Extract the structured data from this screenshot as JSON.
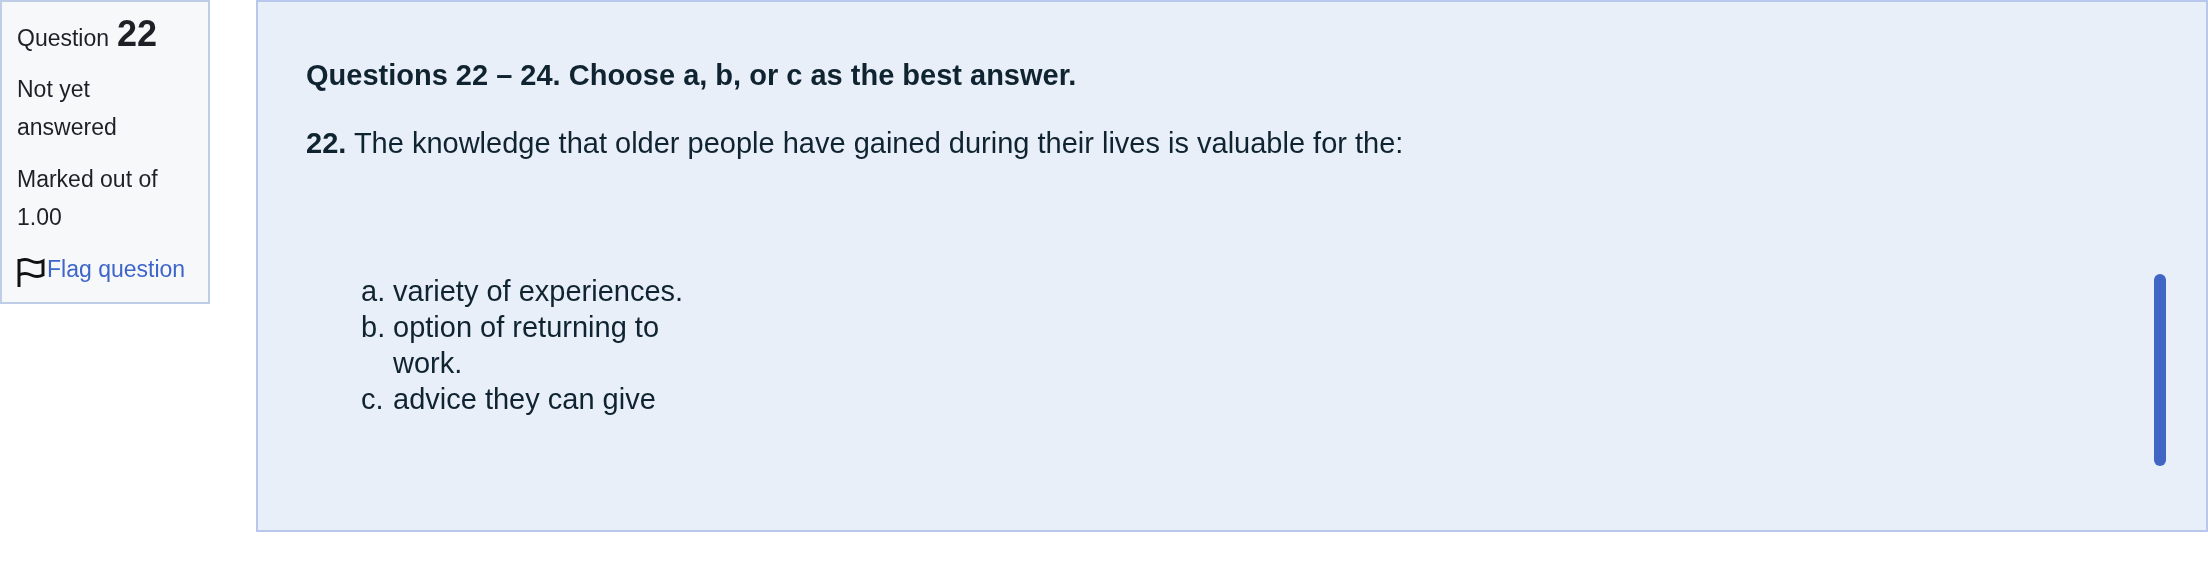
{
  "info": {
    "question_label": "Question",
    "question_number": "22",
    "state": "Not yet answered",
    "marks": "Marked out of 1.00",
    "flag_link": "Flag question"
  },
  "question": {
    "instructions": "Questions 22 – 24. Choose a, b, or c as the best answer.",
    "number": "22.",
    "text": "The knowledge that older people have gained during their lives is valuable for the:",
    "options": [
      {
        "letter": "a.",
        "text": "variety of experiences."
      },
      {
        "letter": "b.",
        "text": "option of returning to work."
      },
      {
        "letter": "c.",
        "text": "advice they can give"
      }
    ]
  }
}
